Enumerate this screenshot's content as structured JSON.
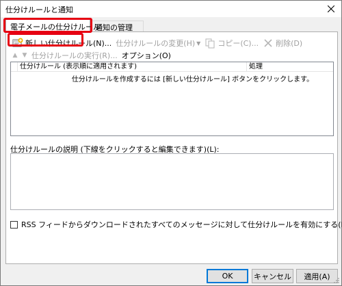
{
  "window": {
    "title": "仕分けルールと通知",
    "close_label": "×"
  },
  "tabs": [
    {
      "label": "電子メールの仕分けルール",
      "active": true
    },
    {
      "label": "通知の管理",
      "active": false
    }
  ],
  "toolbar": {
    "new_rule": "新しい仕分けルール(N)...",
    "change_rule": "仕分けルールの変更(H)",
    "copy": "コピー(C)...",
    "delete": "削除(D)",
    "run_rules": "仕分けルールの実行(R)...",
    "options": "オプション(O)"
  },
  "rules_list": {
    "columns": [
      "",
      "仕分けルール (表示順に適用されます)",
      "処理"
    ],
    "empty_message": "仕分けルールを作成するには [新しい仕分けルール] ボタンをクリックします。"
  },
  "description": {
    "label": "仕分けルールの説明 (下線をクリックすると編集できます)(L):"
  },
  "rss_option": {
    "label": "RSS フィードからダウンロードされたすべてのメッセージに対して仕分けルールを有効にする(E)",
    "checked": false
  },
  "buttons": {
    "ok": "OK",
    "cancel": "キャンセル",
    "apply": "適用(A)"
  },
  "colors": {
    "highlight": "#e60012",
    "accent": "#0078d7"
  }
}
